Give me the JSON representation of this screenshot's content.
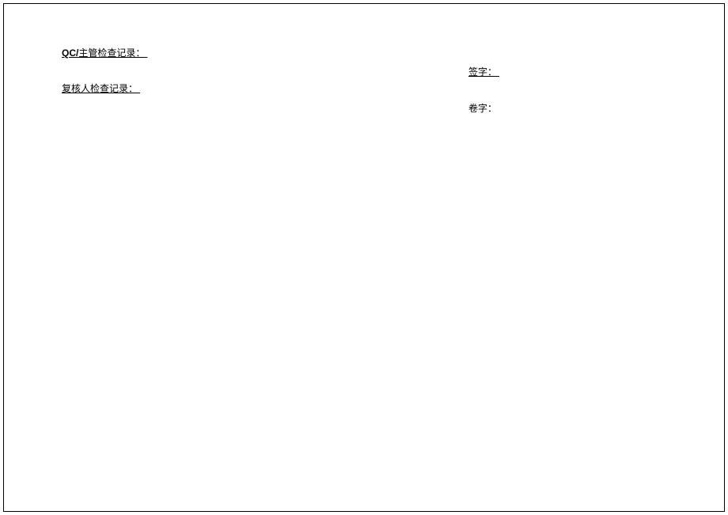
{
  "section1": {
    "prefix": "QC/",
    "label": "主管检查记录：",
    "signature_label": "签字："
  },
  "section2": {
    "label": "复核人检查记录：",
    "signature_label": "卷字："
  }
}
